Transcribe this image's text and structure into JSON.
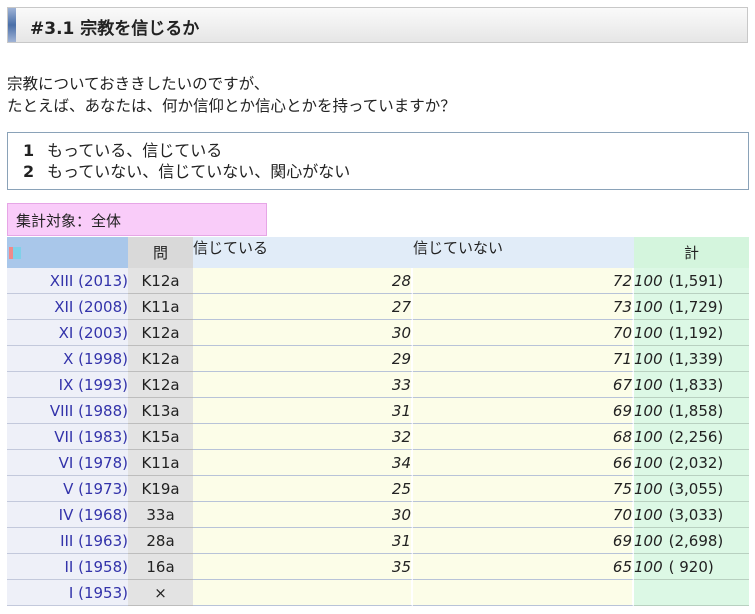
{
  "title": "#3.1 宗教を信じるか",
  "question_lines": [
    "宗教についておききしたいのですが、",
    "たとえば、あなたは、何か信仰とか信心とかを持っていますか？"
  ],
  "choices": [
    {
      "num": "1",
      "label": "もっている、信じている"
    },
    {
      "num": "2",
      "label": "もっていない、信じていない、関心がない"
    }
  ],
  "target_label": "集計対象：全体",
  "table": {
    "headers": {
      "question": "問",
      "col_a": "信じている",
      "col_b": "信じていない",
      "total": "計"
    },
    "rows": [
      {
        "label": "XIII (2013)",
        "q": "K12a",
        "a": "28",
        "b": "72",
        "total": "100",
        "n": "(1,591)"
      },
      {
        "label": "XII (2008)",
        "q": "K11a",
        "a": "27",
        "b": "73",
        "total": "100",
        "n": "(1,729)"
      },
      {
        "label": "XI (2003)",
        "q": "K12a",
        "a": "30",
        "b": "70",
        "total": "100",
        "n": "(1,192)"
      },
      {
        "label": "X (1998)",
        "q": "K12a",
        "a": "29",
        "b": "71",
        "total": "100",
        "n": "(1,339)"
      },
      {
        "label": "IX (1993)",
        "q": "K12a",
        "a": "33",
        "b": "67",
        "total": "100",
        "n": "(1,833)"
      },
      {
        "label": "VIII (1988)",
        "q": "K13a",
        "a": "31",
        "b": "69",
        "total": "100",
        "n": "(1,858)"
      },
      {
        "label": "VII (1983)",
        "q": "K15a",
        "a": "32",
        "b": "68",
        "total": "100",
        "n": "(2,256)"
      },
      {
        "label": "VI (1978)",
        "q": "K11a",
        "a": "34",
        "b": "66",
        "total": "100",
        "n": "(2,032)"
      },
      {
        "label": "V (1973)",
        "q": "K19a",
        "a": "25",
        "b": "75",
        "total": "100",
        "n": "(3,055)"
      },
      {
        "label": "IV (1968)",
        "q": "33a",
        "a": "30",
        "b": "70",
        "total": "100",
        "n": "(3,033)"
      },
      {
        "label": "III (1963)",
        "q": "28a",
        "a": "31",
        "b": "69",
        "total": "100",
        "n": "(2,698)"
      },
      {
        "label": "II (1958)",
        "q": "16a",
        "a": "35",
        "b": "65",
        "total": "100",
        "n": "( 920)"
      },
      {
        "label": "I (1953)",
        "q": "×",
        "a": "",
        "b": "",
        "total": "",
        "n": ""
      }
    ]
  }
}
